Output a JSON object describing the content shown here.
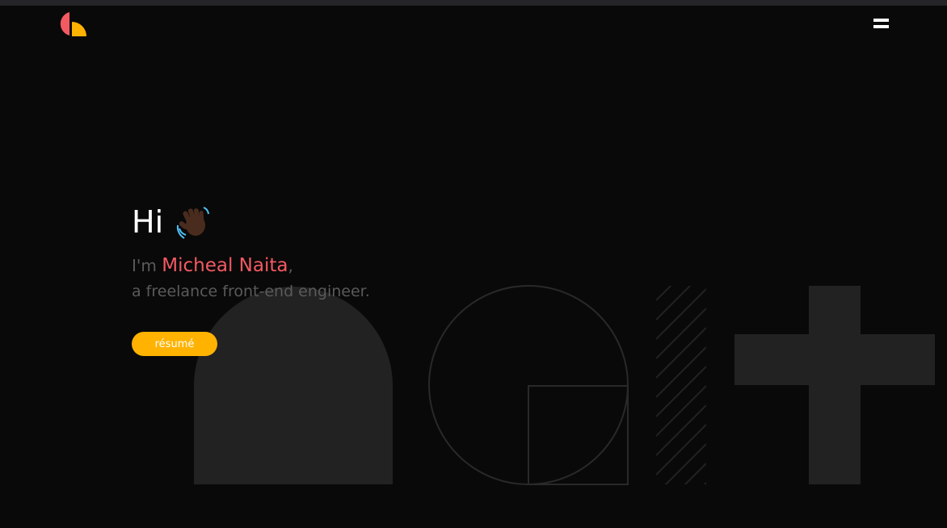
{
  "header": {
    "logo_icon": "half-circle-logo-icon",
    "menu_icon": "hamburger-menu-icon"
  },
  "hero": {
    "greeting": "Hi",
    "wave_icon": "waving-hand-icon",
    "intro_prefix": "I'm ",
    "name": "Micheal Naita",
    "intro_suffix": ",",
    "subtitle": "a freelance front-end engineer.",
    "resume_label": "résumé"
  },
  "colors": {
    "background": "#0a0909",
    "accent_red": "#f25a62",
    "accent_yellow": "#ffb300",
    "shape_fill": "#232222",
    "muted_text": "#5b5a5a"
  }
}
